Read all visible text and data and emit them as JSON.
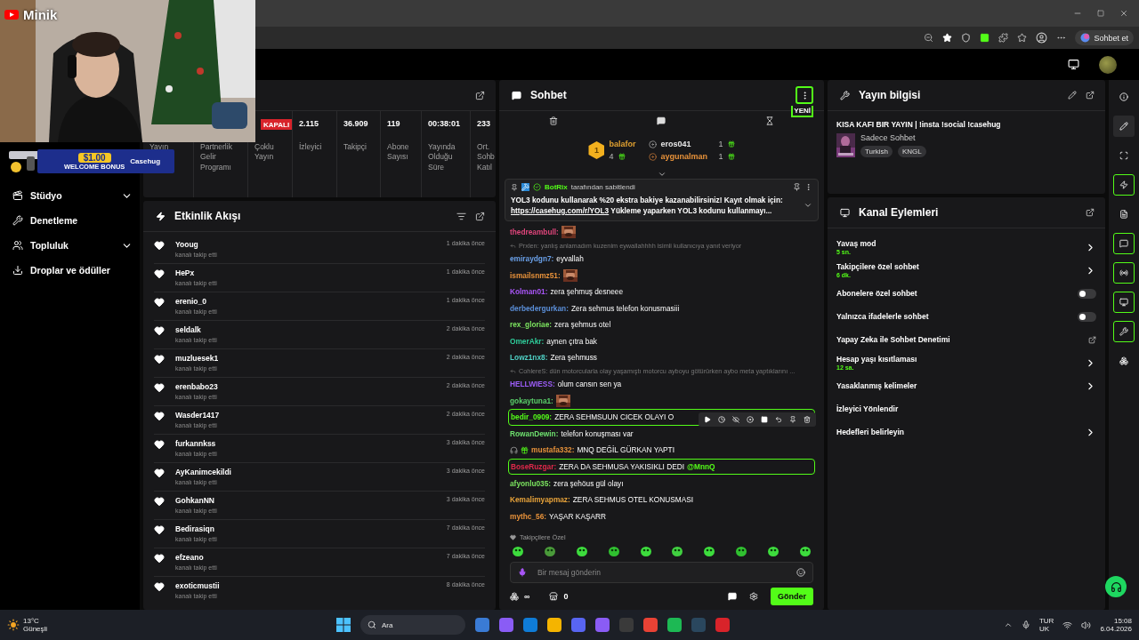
{
  "browser": {
    "copilot_label": "Sohbet et"
  },
  "overlay": {
    "channel": "Minik",
    "banner": {
      "amount": "$1.00",
      "caption": "WELCOME BONUS",
      "brand": "Casehug"
    }
  },
  "sidebar": {
    "items": [
      {
        "label": "Stüdyo",
        "expandable": true
      },
      {
        "label": "Denetleme",
        "expandable": false
      },
      {
        "label": "Topluluk",
        "expandable": true
      },
      {
        "label": "Droplar ve ödüller",
        "expandable": false
      }
    ]
  },
  "stats": [
    {
      "label": "Yayın"
    },
    {
      "label": "Partnerlik Gelir Programı"
    },
    {
      "badge": "KAPALI",
      "label": "Çoklu Yayın"
    },
    {
      "value": "2.115",
      "label": "İzleyici"
    },
    {
      "value": "36.909",
      "label": "Takipçi"
    },
    {
      "value": "119",
      "label": "Abone Sayısı"
    },
    {
      "value": "00:38:01",
      "label": "Yayında Olduğu Süre"
    },
    {
      "value": "233",
      "label": "Ort. Sohb Katıl"
    }
  ],
  "activity": {
    "title": "Etkinlik Akışı",
    "events": [
      {
        "name": "Yooug",
        "action": "kanalı takip etti",
        "time": "1 dakika önce"
      },
      {
        "name": "HePx",
        "action": "kanalı takip etti",
        "time": "1 dakika önce"
      },
      {
        "name": "erenio_0",
        "action": "kanalı takip etti",
        "time": "1 dakika önce"
      },
      {
        "name": "seldalk",
        "action": "kanalı takip etti",
        "time": "2 dakika önce"
      },
      {
        "name": "muzluesek1",
        "action": "kanalı takip etti",
        "time": "2 dakika önce"
      },
      {
        "name": "erenbabo23",
        "action": "kanalı takip etti",
        "time": "2 dakika önce"
      },
      {
        "name": "Wasder1417",
        "action": "kanalı takip etti",
        "time": "2 dakika önce"
      },
      {
        "name": "furkannkss",
        "action": "kanalı takip etti",
        "time": "3 dakika önce"
      },
      {
        "name": "AyKanimcekildi",
        "action": "kanalı takip etti",
        "time": "3 dakika önce"
      },
      {
        "name": "GohkanNN",
        "action": "kanalı takip etti",
        "time": "3 dakika önce"
      },
      {
        "name": "Bedirasiqn",
        "action": "kanalı takip etti",
        "time": "7 dakika önce"
      },
      {
        "name": "efzeano",
        "action": "kanalı takip etti",
        "time": "7 dakika önce"
      },
      {
        "name": "exoticmustii",
        "action": "kanalı takip etti",
        "time": "8 dakika önce"
      }
    ]
  },
  "chat": {
    "title": "Sohbet",
    "new_badge": "YENİ",
    "leaders": [
      {
        "rank": "1",
        "name": "balafor",
        "count": "4",
        "color": "#e0a030"
      },
      {
        "name": "eros041",
        "count": "1",
        "color": "#e8e8e8"
      },
      {
        "name": "aygunalman",
        "count": "1",
        "color": "#e8923a"
      }
    ],
    "pinned": {
      "author": "BotRix",
      "note": "tarafından sabitlendi",
      "text": "YOL3 kodunu kullanarak %20 ekstra bakiye kazanabilirsiniz! Kayıt olmak için:",
      "link": "https://casehug.com/r/YOL3",
      "more": "Yükleme yaparken YOL3 kodunu kullanmayı..."
    },
    "messages": [
      {
        "kind": "emote",
        "name": "thedreambull:",
        "color": "#e0457b",
        "highlighted": false,
        "hovered": false
      },
      {
        "kind": "reply",
        "text": "Prxlen: yanlış anlamadım kuzenim eywallahhhh isimli kullanıcıya yanıt veriyor",
        "highlighted": false,
        "hovered": false
      },
      {
        "kind": "text",
        "name": "emiraydgn7:",
        "text": "eyvallah",
        "color": "#6aa0e8",
        "highlighted": false,
        "hovered": false
      },
      {
        "kind": "emote",
        "name": "ismailsnmz51:",
        "color": "#e8923a",
        "highlighted": false,
        "hovered": false
      },
      {
        "kind": "text",
        "name": "Kolman01:",
        "text": "zera şehmuş desneee",
        "color": "#a855f7",
        "highlighted": false,
        "hovered": false
      },
      {
        "kind": "text",
        "name": "derbedergurkan:",
        "text": "Zera sehmus telefon konusmasiii",
        "color": "#5b8fd9",
        "highlighted": false,
        "hovered": false
      },
      {
        "kind": "text",
        "name": "rex_gloriae:",
        "text": "zera şehmus otel",
        "color": "#7be35f",
        "highlighted": false,
        "hovered": false
      },
      {
        "kind": "text",
        "name": "OmerAkr:",
        "text": "aynen çıtra bak",
        "color": "#2ecc9a",
        "highlighted": false,
        "hovered": false
      },
      {
        "kind": "text",
        "name": "Lowz1nx8:",
        "text": "Zera şehmuss",
        "color": "#4fd1c5",
        "highlighted": false,
        "hovered": false
      },
      {
        "kind": "reply",
        "text": "CohlereS: dün motorcularla olay yaşamıştı motorcu ayboyu götürürken aybo meta yaptıklarını ...",
        "highlighted": false,
        "hovered": false
      },
      {
        "kind": "text",
        "name": "HELLWIESS:",
        "text": "olum cansın sen ya",
        "color": "#9b5cf6",
        "highlighted": false,
        "hovered": false
      },
      {
        "kind": "emote",
        "name": "gokaytuna1:",
        "color": "#5ad06a",
        "highlighted": false,
        "hovered": false
      },
      {
        "kind": "text",
        "name": "bedir_0909:",
        "text": "ZERA SEHMSUUN CICEK OLAYI O",
        "color": "#53fc18",
        "highlighted": true,
        "hovered": true
      },
      {
        "kind": "text",
        "name": "RowanDewin:",
        "text": "telefon konuşması var",
        "color": "#6ee06e",
        "highlighted": false,
        "hovered": false
      },
      {
        "kind": "badged",
        "name": "mustafa332:",
        "text": "MNQ DEĞİL GÜRKAN YAPTI",
        "color": "#e8923a",
        "highlighted": false,
        "hovered": false
      },
      {
        "kind": "text",
        "name": "BoseRuzgar:",
        "text": "ZERA DA SEHMUSA YAKISIKLI DEDI",
        "mention": "@MnnQ",
        "color": "#e0284a",
        "highlighted": true,
        "hovered": false
      },
      {
        "kind": "text",
        "name": "afyonlu035:",
        "text": "zera şehöus gül olayı",
        "color": "#7be35f",
        "highlighted": false,
        "hovered": false
      },
      {
        "kind": "text",
        "name": "Kemalimyapmaz:",
        "text": "ZERA SEHMUS OTEL KONUSMASI",
        "color": "#e8a33a",
        "highlighted": false,
        "hovered": false
      },
      {
        "kind": "text",
        "name": "mythc_56:",
        "text": "YAŞAR KAŞARR",
        "color": "#e8923a",
        "highlighted": false,
        "hovered": false
      }
    ],
    "emote_section": "Takipçilere Özel",
    "input": {
      "placeholder": "Bir mesaj gönderin"
    },
    "points": "∞",
    "store_count": "0",
    "send": "Gönder"
  },
  "stream_info": {
    "title": "Yayın bilgisi",
    "stream_title": "KISA KAFI BIR YAYIN | !insta !social !casehug",
    "category": "Sadece Sohbet",
    "tags": [
      "Turkish",
      "KNGL"
    ]
  },
  "channel_actions": {
    "title": "Kanal Eylemleri",
    "items": [
      {
        "kind": "chevron",
        "label": "Yavaş mod",
        "value": "5 sn."
      },
      {
        "kind": "chevron",
        "label": "Takipçilere özel sohbet",
        "value": "6 dk."
      },
      {
        "kind": "toggle",
        "label": "Abonelere özel sohbet",
        "on": false
      },
      {
        "kind": "toggle",
        "label": "Yalnızca ifadelerle sohbet",
        "on": false
      },
      {
        "kind": "external",
        "label": "Yapay Zeka ile Sohbet Denetimi"
      },
      {
        "kind": "chevron",
        "label": "Hesap yaşı kısıtlaması",
        "value": "12 sa."
      },
      {
        "kind": "chevron",
        "label": "Yasaklanmış kelimeler"
      },
      {
        "kind": "plain",
        "label": "İzleyici Yönlendir"
      },
      {
        "kind": "chevron",
        "label": "Hedefleri belirleyin"
      }
    ]
  },
  "rail": [
    {
      "selected": false,
      "active": false
    },
    {
      "selected": true,
      "active": false
    },
    {
      "selected": false,
      "active": false
    },
    {
      "selected": false,
      "active": true
    },
    {
      "selected": false,
      "active": false
    },
    {
      "selected": false,
      "active": true
    },
    {
      "selected": false,
      "active": true
    },
    {
      "selected": false,
      "active": true
    },
    {
      "selected": false,
      "active": true
    },
    {
      "selected": false,
      "active": false
    }
  ],
  "taskbar": {
    "temperature": "13°C",
    "weather": "Güneşli",
    "search": "Ara",
    "language": "TUR",
    "layout": "UK",
    "time": "15:08",
    "date": "6.04.2026"
  }
}
